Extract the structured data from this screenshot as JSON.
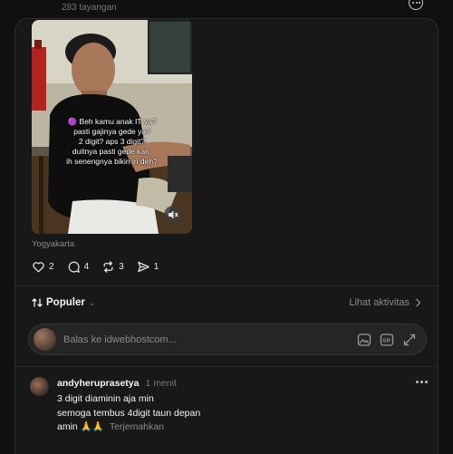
{
  "header": {
    "views_text": "283 tayangan"
  },
  "post": {
    "video": {
      "caption_lines": [
        "🟣 Beh kamu anak IT ya?",
        "pasti gajinya gede ya?",
        "2 digit? aps 3 digit?",
        "duitnya pasti gede kan,",
        "ih senengnya bikin iri deh?"
      ],
      "muted": true
    },
    "location": "Yogyakarta",
    "actions": {
      "likes": "2",
      "replies": "4",
      "reposts": "3",
      "shares": "1"
    }
  },
  "replies_section": {
    "sort_label": "Populer",
    "activity_link": "Lihat aktivitas",
    "reply_placeholder": "Balas ke idwebhostcom..."
  },
  "comment": {
    "username": "andyheruprasetya",
    "time": "1 menit",
    "lines": [
      "3 digit diaminin aja min",
      "semoga tembus 4digit taun depan"
    ],
    "last_line": "amin 🙏🙏",
    "translate_label": "Terjemahkan"
  },
  "colors": {
    "background": "#101010",
    "card": "#181818",
    "text_primary": "#f3f5f7",
    "text_secondary": "#8a8a8a"
  },
  "icons": [
    "more-icon",
    "volume-mute-icon",
    "heart-icon",
    "comment-icon",
    "repost-icon",
    "share-icon",
    "sort-icon",
    "chevron-down-icon",
    "chevron-right-icon",
    "image-icon",
    "gif-icon",
    "expand-icon"
  ]
}
